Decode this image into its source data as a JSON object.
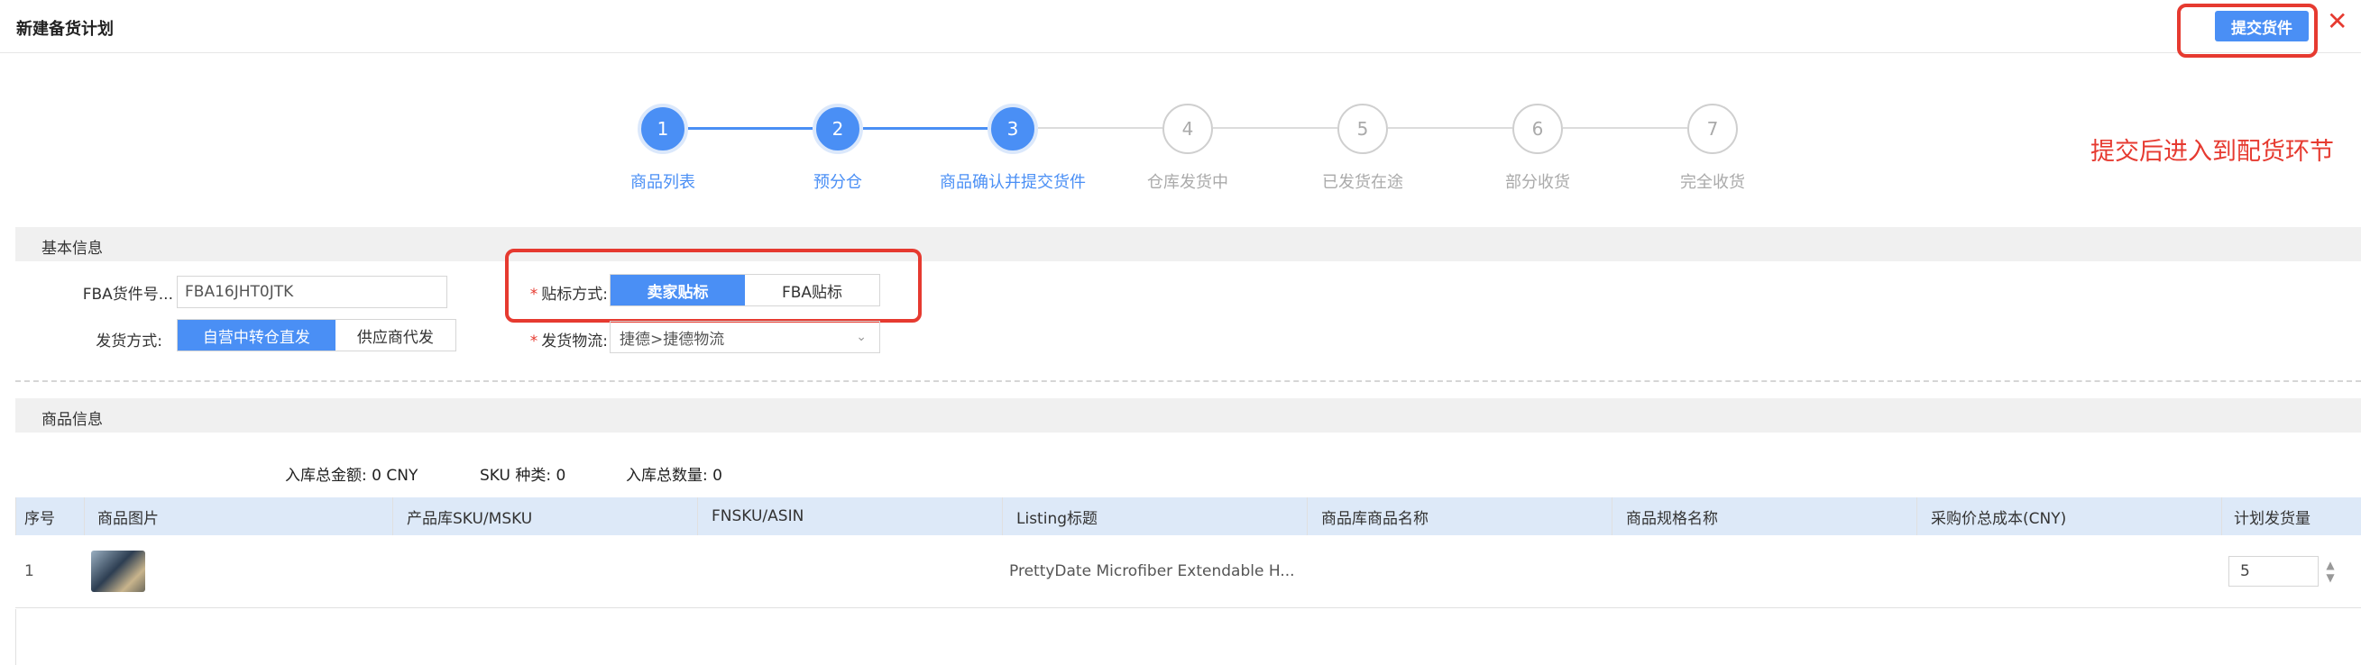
{
  "header": {
    "title": "新建备货计划",
    "submit_label": "提交货件",
    "close_symbol": "✕"
  },
  "annotation": "提交后进入到配货环节",
  "steps": [
    {
      "num": "1",
      "label": "商品列表",
      "state": "done"
    },
    {
      "num": "2",
      "label": "预分仓",
      "state": "done"
    },
    {
      "num": "3",
      "label": "商品确认并提交货件",
      "state": "current"
    },
    {
      "num": "4",
      "label": "仓库发货中",
      "state": "pending"
    },
    {
      "num": "5",
      "label": "已发货在途",
      "state": "pending"
    },
    {
      "num": "6",
      "label": "部分收货",
      "state": "pending"
    },
    {
      "num": "7",
      "label": "完全收货",
      "state": "pending"
    }
  ],
  "basic_info": {
    "section_title": "基本信息",
    "fba_label": "FBA货件号...",
    "fba_value": "FBA16JHT0JTK",
    "label_method_label": "贴标方式:",
    "label_method_options": [
      "卖家贴标",
      "FBA贴标"
    ],
    "ship_method_label": "发货方式:",
    "ship_method_options": [
      "自营中转仓直发",
      "供应商代发"
    ],
    "logistics_label": "发货物流:",
    "logistics_value": "捷德>捷德物流"
  },
  "product_info": {
    "section_title": "商品信息",
    "total_amount": "入库总金额: 0 CNY",
    "sku_count": "SKU 种类: 0",
    "total_qty": "入库总数量: 0"
  },
  "table": {
    "headers": [
      "序号",
      "商品图片",
      "产品库SKU/MSKU",
      "FNSKU/ASIN",
      "Listing标题",
      "商品库商品名称",
      "商品规格名称",
      "采购价总成本(CNY)",
      "计划发货量"
    ],
    "rows": [
      {
        "index": "1",
        "image": "product-thumbnail",
        "sku": "",
        "fnsku": "",
        "listing": "PrettyDate Microfiber Extendable H...",
        "product_name": "",
        "spec_name": "",
        "cost": "",
        "qty": "5"
      }
    ]
  },
  "colors": {
    "primary": "#4a8ff5",
    "annotation_red": "#e63a30",
    "header_bg": "#dde9f8"
  }
}
